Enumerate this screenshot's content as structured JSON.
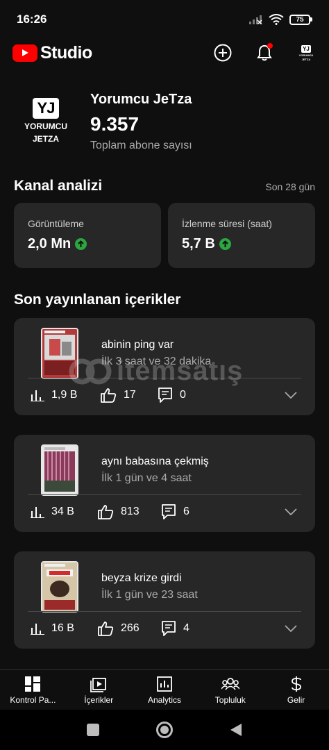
{
  "status_bar": {
    "time": "16:26",
    "battery": "75"
  },
  "header": {
    "brand": "Studio"
  },
  "channel": {
    "avatar_initials": "YJ",
    "avatar_subtitle_1": "YORUMCU",
    "avatar_subtitle_2": "JETZA",
    "name": "Yorumcu JeTza",
    "subscribers": "9.357",
    "subscribers_label": "Toplam abone sayısı"
  },
  "analytics": {
    "title": "Kanal analizi",
    "period": "Son 28 gün",
    "cards": [
      {
        "label": "Görüntüleme",
        "value": "2,0 Mn",
        "trend": "up"
      },
      {
        "label": "İzlenme süresi (saat)",
        "value": "5,7 B",
        "trend": "up"
      }
    ]
  },
  "recent": {
    "title": "Son yayınlanan içerikler",
    "items": [
      {
        "title": "abinin ping var",
        "time": "İlk 3 saat ve 32 dakika",
        "views": "1,9 B",
        "likes": "17",
        "comments": "0"
      },
      {
        "title": "aynı babasına çekmiş",
        "time": "İlk 1 gün ve 4 saat",
        "views": "34 B",
        "likes": "813",
        "comments": "6"
      },
      {
        "title": "beyza krize girdi",
        "time": "İlk 1 gün ve 23 saat",
        "views": "16 B",
        "likes": "266",
        "comments": "4"
      }
    ]
  },
  "watermark": {
    "text": "itemsatış"
  },
  "bottom_nav": [
    {
      "label": "Kontrol Pa...",
      "icon": "dashboard-icon"
    },
    {
      "label": "İçerikler",
      "icon": "content-icon"
    },
    {
      "label": "Analytics",
      "icon": "analytics-icon"
    },
    {
      "label": "Topluluk",
      "icon": "community-icon"
    },
    {
      "label": "Gelir",
      "icon": "dollar-icon"
    }
  ],
  "colors": {
    "brand_red": "#ff0000",
    "card_bg": "#272727",
    "trend_green": "#2ba640",
    "background": "#0f0f0f"
  }
}
